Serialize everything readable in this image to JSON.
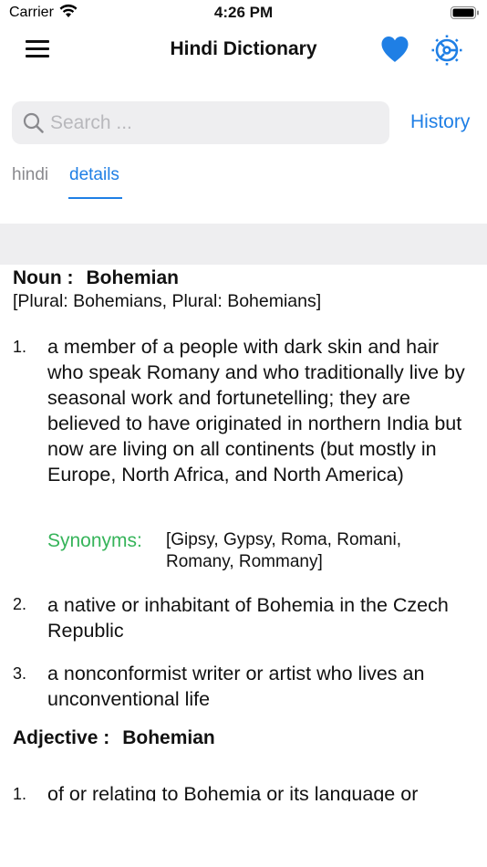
{
  "status_bar": {
    "carrier": "Carrier",
    "time": "4:26 PM"
  },
  "nav": {
    "title": "Hindi Dictionary",
    "icons": [
      "menu-icon",
      "heart-icon",
      "gear-icon"
    ],
    "accent_color": "#1f7fe5"
  },
  "search": {
    "placeholder": "Search ...",
    "value": "",
    "history_label": "History"
  },
  "tabs": [
    {
      "label": "hindi",
      "selected": false
    },
    {
      "label": "details",
      "selected": true
    }
  ],
  "entry": {
    "noun": {
      "label": "Noun :",
      "word": "Bohemian",
      "plural": "[Plural: Bohemians, Plural: Bohemians]",
      "definitions": [
        {
          "num": "1.",
          "text": "a member of a people with dark skin and hair who speak Romany and who traditionally live by seasonal work and fortunetelling; they are believed to have originated in northern India but now are living on all continents (but mostly in Europe, North Africa, and North America)",
          "synonyms_label": "Synonyms:",
          "synonyms": "[Gipsy, Gypsy, Roma, Romani, Romany, Rommany]"
        },
        {
          "num": "2.",
          "text": "a native or inhabitant of Bohemia in the Czech Republic"
        },
        {
          "num": "3.",
          "text": "a nonconformist writer or artist who lives an unconventional life"
        }
      ]
    },
    "adjective": {
      "label": "Adjective :",
      "word": "Bohemian",
      "definitions": [
        {
          "num": "1.",
          "text": "of or relating to Bohemia or its language or people"
        }
      ]
    }
  },
  "colors": {
    "synonym_label": "#36b45a",
    "band": "#eeeef0"
  }
}
